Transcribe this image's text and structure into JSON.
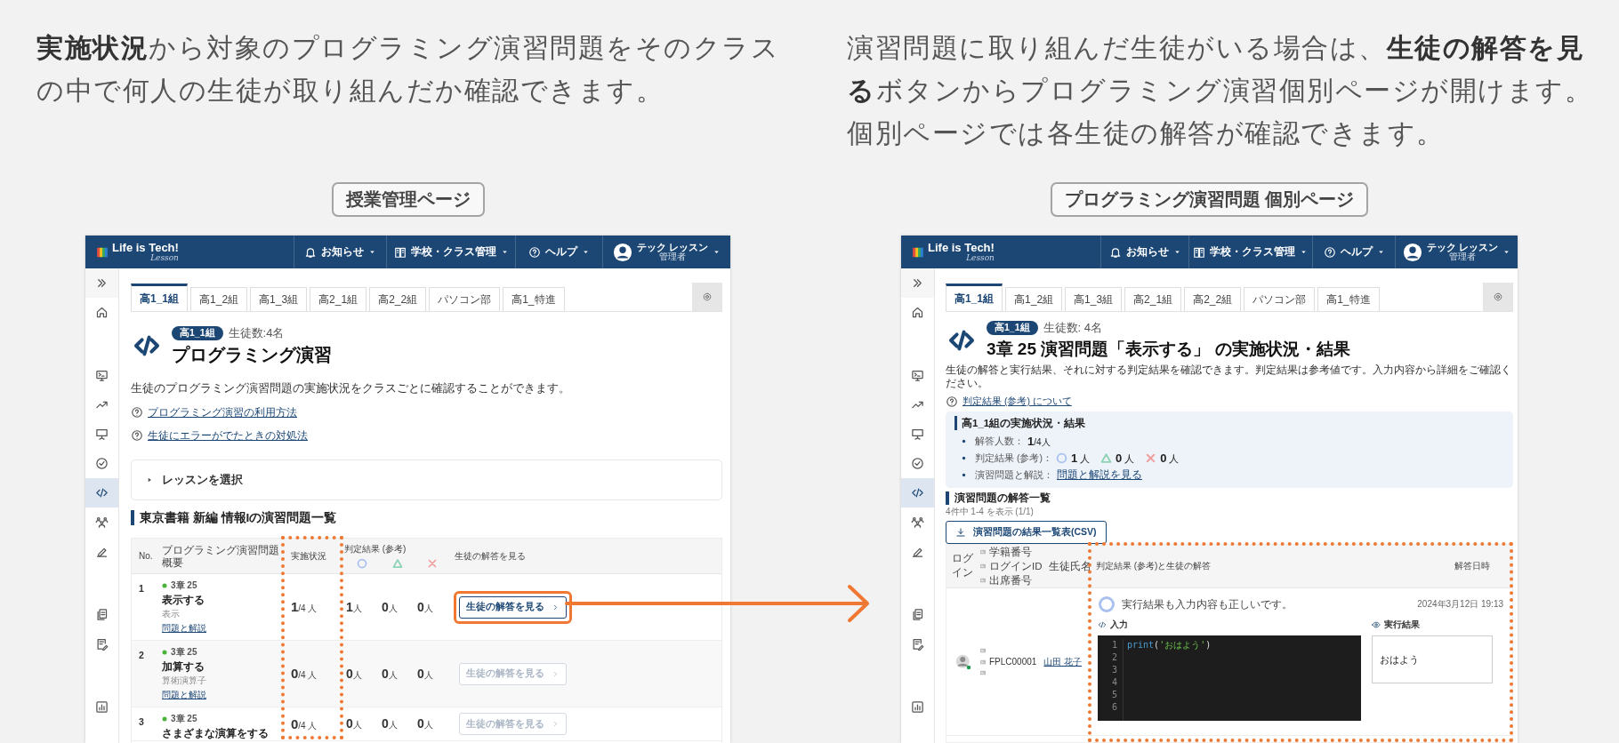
{
  "overview_panel": {
    "caption": "**実施状況**から対象のプログラミング演習問題をそのクラスの中で何人の生徒が取り組んだか確認できます。",
    "label": "授業管理ページ",
    "screen": {
      "app_header": {
        "logo": "Life is Tech!",
        "logo_sub": "Lesson",
        "menus": [
          {
            "kind": "bell",
            "label": "お知らせ"
          },
          {
            "kind": "building",
            "label": "学校・クラス管理"
          },
          {
            "kind": "help",
            "label": "ヘルプ"
          }
        ],
        "user": {
          "name": "テック レッスン",
          "role": "管理者"
        }
      },
      "sidebar": {
        "groups": [
          {
            "items": [
              {
                "kind": "expand",
                "selected": false
              },
              {
                "kind": "home",
                "selected": false
              }
            ]
          },
          {
            "items": [
              {
                "kind": "terminal",
                "selected": false
              },
              {
                "kind": "trend",
                "selected": false
              },
              {
                "kind": "presentation",
                "selected": false
              },
              {
                "kind": "check",
                "selected": false
              },
              {
                "kind": "code",
                "selected": true
              },
              {
                "kind": "people",
                "selected": false
              },
              {
                "kind": "pencil",
                "selected": false
              }
            ]
          },
          {
            "items": [
              {
                "kind": "docs",
                "selected": false
              },
              {
                "kind": "docedit",
                "selected": false
              }
            ]
          },
          {
            "items": [
              {
                "kind": "chart",
                "selected": false
              }
            ]
          }
        ]
      },
      "tabs": [
        {
          "label": "高1_1組",
          "selected": true
        },
        {
          "label": "高1_2組",
          "selected": false
        },
        {
          "label": "高1_3組",
          "selected": false
        },
        {
          "label": "高2_1組",
          "selected": false
        },
        {
          "label": "高2_2組",
          "selected": false
        },
        {
          "label": "パソコン部",
          "selected": false
        },
        {
          "label": "高1_特進",
          "selected": false
        }
      ],
      "page_heading": {
        "badge": "高1_1組",
        "student_count": "生徒数:4名",
        "title": "プログラミング演習"
      },
      "description": "生徒のプログラミング演習問題の実施状況をクラスごとに確認することができます。",
      "help_links": [
        "プログラミング演習の利用方法",
        "生徒にエラーがでたときの対処法"
      ],
      "lesson_selector": {
        "label": "レッスンを選択",
        "expanded": false
      },
      "section_heading": "東京書籍 新編 情報Iの演習問題一覧",
      "table": {
        "columns": [
          {
            "label": "No.",
            "highlighted": false
          },
          {
            "label": "プログラミング演習問題概要",
            "highlighted": false
          },
          {
            "label": "実施状況",
            "highlighted": true
          },
          {
            "label": "判定結果 (参考)",
            "highlighted": false
          },
          {
            "label": "生徒の解答を見る",
            "highlighted": false
          }
        ],
        "result_icons": [
          {
            "kind": "correct"
          },
          {
            "kind": "partial"
          },
          {
            "kind": "wrong"
          }
        ],
        "rows": [
          {
            "no": "1",
            "chapter": "3章 25",
            "title": "表示する",
            "topic": "表示",
            "link": "問題と解説",
            "done": "1",
            "total": "/4 人",
            "results": [
              {
                "count": "1",
                "unit": "人"
              },
              {
                "count": "0",
                "unit": "人"
              },
              {
                "count": "0",
                "unit": "人"
              }
            ],
            "button": {
              "label": "生徒の解答を見る",
              "disabled": false,
              "highlighted": true
            }
          },
          {
            "no": "2",
            "chapter": "3章 25",
            "title": "加算する",
            "topic": "算術演算子",
            "link": "問題と解説",
            "done": "0",
            "total": "/4 人",
            "results": [
              {
                "count": "0",
                "unit": "人"
              },
              {
                "count": "0",
                "unit": "人"
              },
              {
                "count": "0",
                "unit": "人"
              }
            ],
            "button": {
              "label": "生徒の解答を見る",
              "disabled": true,
              "highlighted": false
            }
          },
          {
            "no": "3",
            "chapter": "3章 25",
            "title": "さまざまな演算をする",
            "done": "0",
            "total": "/4 人",
            "results": [
              {
                "count": "0",
                "unit": "人"
              },
              {
                "count": "0",
                "unit": "人"
              },
              {
                "count": "0",
                "unit": "人"
              }
            ],
            "button": {
              "label": "生徒の解答を見る",
              "disabled": true,
              "highlighted": false
            }
          }
        ]
      }
    }
  },
  "detail_panel": {
    "caption": "演習問題に取り組んだ生徒がいる場合は、**生徒の解答を見る**ボタンからプログラミング演習個別ページが開けます。個別ページでは各生徒の解答が確認できます。",
    "label": "プログラミング演習問題 個別ページ",
    "screen": {
      "app_header": {
        "logo": "Life is Tech!",
        "logo_sub": "Lesson",
        "menus": [
          {
            "kind": "bell",
            "label": "お知らせ"
          },
          {
            "kind": "building",
            "label": "学校・クラス管理"
          },
          {
            "kind": "help",
            "label": "ヘルプ"
          }
        ],
        "user": {
          "name": "テック レッスン",
          "role": "管理者"
        }
      },
      "sidebar": {
        "groups": [
          {
            "items": [
              {
                "kind": "expand",
                "selected": false
              },
              {
                "kind": "home",
                "selected": false
              }
            ]
          },
          {
            "items": [
              {
                "kind": "terminal",
                "selected": false
              },
              {
                "kind": "trend",
                "selected": false
              },
              {
                "kind": "presentation",
                "selected": false
              },
              {
                "kind": "check",
                "selected": false
              },
              {
                "kind": "code",
                "selected": true
              },
              {
                "kind": "people",
                "selected": false
              },
              {
                "kind": "pencil",
                "selected": false
              }
            ]
          },
          {
            "items": [
              {
                "kind": "docs",
                "selected": false
              },
              {
                "kind": "docedit",
                "selected": false
              }
            ]
          },
          {
            "items": [
              {
                "kind": "chart",
                "selected": false
              }
            ]
          }
        ]
      },
      "tabs": [
        {
          "label": "高1_1組",
          "selected": true
        },
        {
          "label": "高1_2組",
          "selected": false
        },
        {
          "label": "高1_3組",
          "selected": false
        },
        {
          "label": "高2_1組",
          "selected": false
        },
        {
          "label": "高2_2組",
          "selected": false
        },
        {
          "label": "パソコン部",
          "selected": false
        },
        {
          "label": "高1_特進",
          "selected": false
        }
      ],
      "page_heading": {
        "badge": "高1_1組",
        "student_count": "生徒数: 4名",
        "title": "3章 25 演習問題「表示する」 の実施状況・結果"
      },
      "description": "生徒の解答と実行結果、それに対する判定結果を確認できます。判定結果は参考値です。入力内容から詳細をご確認ください。",
      "help_links": [
        "判定結果 (参考) について"
      ],
      "summary": {
        "heading": "高1_1組の実施状況・結果",
        "answered": {
          "label": "解答人数：",
          "count": "1",
          "total": "/4人"
        },
        "judgement": {
          "label": "判定結果 (参考)：",
          "results": [
            {
              "kind": "correct",
              "count": "1",
              "unit": "人"
            },
            {
              "kind": "partial",
              "count": "0",
              "unit": "人"
            },
            {
              "kind": "wrong",
              "count": "0",
              "unit": "人"
            }
          ]
        },
        "explanation": {
          "label": "演習問題と解説：",
          "link": "問題と解説を見る"
        }
      },
      "section_heading": "演習問題の解答一覧",
      "pagination": "4件中 1-4 を表示 (1/1)",
      "csv_button": "演習問題の結果一覧表(CSV)",
      "answers_table": {
        "columns": {
          "login": "ログイン",
          "id_fields": [
            "学籍番号",
            "ログインID",
            "出席番号"
          ],
          "name": "生徒氏名",
          "answer": "判定結果 (参考)と生徒の解答",
          "date": "解答日時"
        },
        "answer_highlighted": true,
        "rows": [
          {
            "login_id": "FPLC00001",
            "name": "山田 花子",
            "result": {
              "kind": "correct",
              "message": "実行結果も入力内容も正しいです。"
            },
            "date": "2024年3月12日 19:13",
            "input_label": "入力",
            "line_numbers": [
              "1",
              "2",
              "3",
              "4",
              "5",
              "6"
            ],
            "code_lines": [
              "print('おはよう')"
            ],
            "output_label": "実行結果",
            "output": "おはよう"
          }
        ]
      }
    }
  }
}
